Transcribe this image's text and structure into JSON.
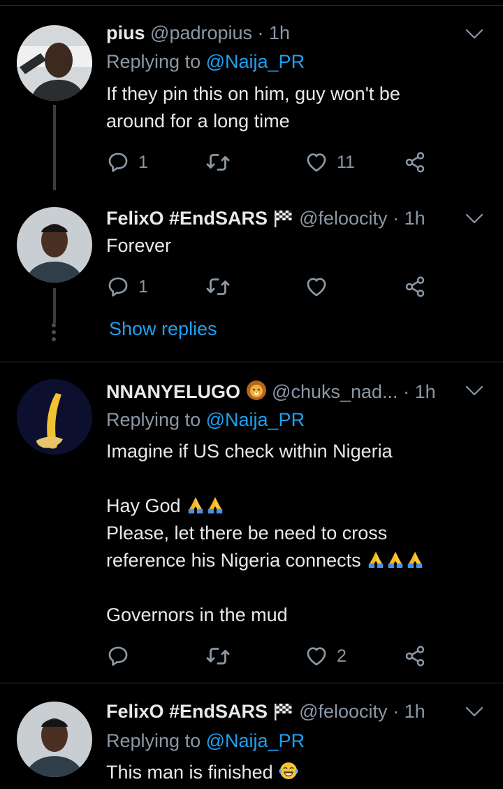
{
  "tweets": [
    {
      "name": "pius",
      "handle": "@padropius",
      "time": "· 1h",
      "replying_prefix": "Replying to",
      "replying_to": "@Naija_PR",
      "text": "If they pin this on him, guy won't be\naround for a long time",
      "reply_count": "1",
      "like_count": "11"
    },
    {
      "name": "FelixO #EndSARS",
      "handle": "@feloocity",
      "time": "· 1h",
      "text": "Forever",
      "reply_count": "1",
      "like_count": ""
    },
    {
      "name": "NNANYELUGO",
      "handle": "@chuks_nad...",
      "time": "· 1h",
      "replying_prefix": "Replying to",
      "replying_to": "@Naija_PR",
      "line1": "Imagine if US check within Nigeria",
      "line2": "Hay God",
      "line3": "Please, let there be need to cross",
      "line4": "reference his Nigeria connects",
      "line5": "Governors in the mud",
      "reply_count": "",
      "like_count": "2"
    },
    {
      "name": "FelixO #EndSARS",
      "handle": "@feloocity",
      "time": "· 1h",
      "replying_prefix": "Replying to",
      "replying_to": "@Naija_PR",
      "text": "This man is finished"
    }
  ],
  "show_replies": "Show replies",
  "icons": [
    "reply-icon",
    "retweet-icon",
    "like-icon",
    "share-icon",
    "chevron-down-icon",
    "checkered-flag-icon",
    "lion-icon",
    "folded-hands-icon",
    "tears-of-joy-icon"
  ],
  "colors": {
    "background": "#000000",
    "link": "#1da1f2",
    "muted": "#8b98a5",
    "text": "#e7e9ea"
  }
}
